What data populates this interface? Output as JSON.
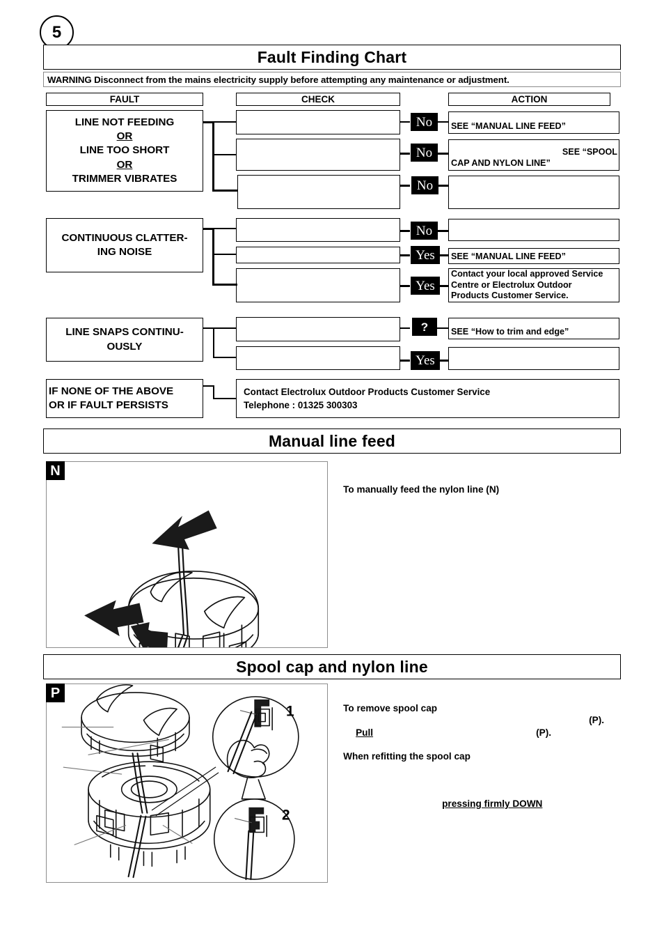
{
  "page": {
    "number": "5"
  },
  "fault_chart": {
    "title": "Fault Finding Chart",
    "warning": "WARNING  Disconnect from the mains electricity supply before attempting any maintenance or adjustment.",
    "columns": {
      "fault": "FAULT",
      "check": "CHECK",
      "action": "ACTION"
    },
    "faults": [
      {
        "lines": [
          "LINE NOT FEEDING",
          "OR",
          "LINE TOO SHORT",
          "OR",
          "TRIMMER VIBRATES"
        ]
      },
      {
        "lines": [
          "CONTINUOUS CLATTER-",
          "ING NOISE"
        ]
      },
      {
        "lines": [
          "LINE SNAPS CONTINU-",
          "OUSLY"
        ]
      },
      {
        "lines": [
          "IF NONE OF THE ABOVE",
          "OR IF FAULT PERSISTS"
        ]
      }
    ],
    "checks": [
      "",
      "",
      "",
      "",
      "",
      "",
      "",
      ""
    ],
    "badges": [
      "No",
      "No",
      "No",
      "No",
      "Yes",
      "Yes",
      "?",
      "Yes"
    ],
    "actions": [
      "SEE “MANUAL LINE FEED”",
      "SEE “SPOOL\nCAP AND NYLON LINE”",
      "",
      "",
      "SEE “MANUAL LINE FEED”",
      "Contact your local approved Service\nCentre or Electrolux Outdoor\nProducts Customer Service.",
      "SEE “How to trim and edge”",
      ""
    ],
    "action_2_line1": "SEE “SPOOL",
    "action_2_line2": "CAP AND NYLON LINE”",
    "action_6_line1": "Contact your local approved Service",
    "action_6_line2": "Centre or Electrolux Outdoor",
    "action_6_line3": "Products Customer Service.",
    "contact": {
      "line1": "Contact Electrolux Outdoor Products Customer Service",
      "line2": "Telephone : 01325 300303"
    }
  },
  "manual_line_feed": {
    "title": "Manual line feed",
    "figure_tag": "N",
    "instruction": "To manually feed the nylon line (N)"
  },
  "spool_cap": {
    "title": "Spool cap and nylon line",
    "figure_tag": "P",
    "callout_1": "1",
    "callout_2": "2",
    "text_remove": "To remove spool cap",
    "text_p_right": "(P).",
    "text_pull": "Pull",
    "text_p_mid": "(P).",
    "text_refit": "When refitting the spool cap",
    "text_press": "pressing firmly DOWN"
  },
  "colors": {
    "ink": "#000000",
    "rule_gray": "#8d8d8d"
  }
}
